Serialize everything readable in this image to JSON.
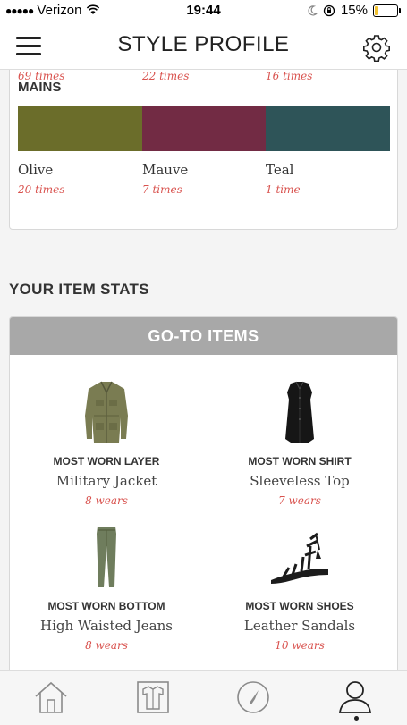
{
  "status": {
    "carrier": "Verizon",
    "signal_dots": "●●●●●",
    "time": "19:44",
    "battery": "15%",
    "battery_level": 0.15
  },
  "header": {
    "title": "STYLE PROFILE"
  },
  "colors_card": {
    "prev_times": [
      "69 times",
      "22 times",
      "16 times"
    ],
    "section_label": "MAINS",
    "mains": [
      {
        "name": "Olive",
        "times": "20 times",
        "color": "#6b6d2a"
      },
      {
        "name": "Mauve",
        "times": "7 times",
        "color": "#722b44"
      },
      {
        "name": "Teal",
        "times": "1 time",
        "color": "#2e5458"
      }
    ]
  },
  "item_stats": {
    "title": "YOUR ITEM STATS",
    "card_title": "GO-TO ITEMS",
    "items": [
      {
        "category": "MOST WORN LAYER",
        "name": "Military Jacket",
        "wears": "8 wears",
        "icon": "jacket-image"
      },
      {
        "category": "MOST WORN SHIRT",
        "name": "Sleeveless Top",
        "wears": "7 wears",
        "icon": "shirt-image"
      },
      {
        "category": "MOST WORN BOTTOM",
        "name": "High Waisted Jeans",
        "wears": "8 wears",
        "icon": "jeans-image"
      },
      {
        "category": "MOST WORN SHOES",
        "name": "Leather Sandals",
        "wears": "10 wears",
        "icon": "sandals-image"
      }
    ]
  },
  "tabbar": {
    "tabs": [
      "home-icon",
      "closet-icon",
      "compass-icon",
      "profile-icon"
    ],
    "active": "profile-icon"
  }
}
